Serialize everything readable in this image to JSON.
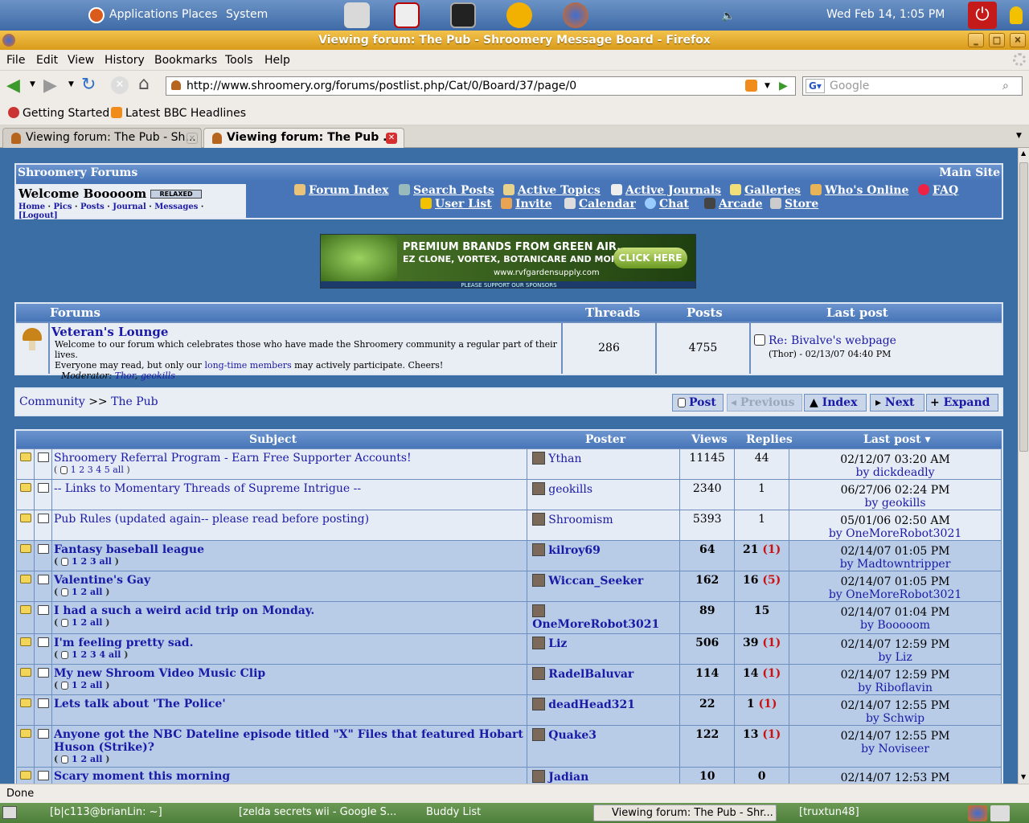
{
  "panel": {
    "applications": "Applications",
    "places": "Places",
    "system": "System",
    "clock": "Wed Feb 14,  1:05 PM"
  },
  "window": {
    "title": "Viewing forum: The Pub - Shroomery Message Board - Firefox"
  },
  "menubar": [
    "File",
    "Edit",
    "View",
    "History",
    "Bookmarks",
    "Tools",
    "Help"
  ],
  "navbar": {
    "url": "http://www.shroomery.org/forums/postlist.php/Cat/0/Board/37/page/0",
    "search_placeholder": "Google"
  },
  "bookmarks": [
    "Getting Started",
    "Latest BBC Headlines"
  ],
  "tabs": [
    {
      "label": "Viewing forum: The Pub - Sh..."
    },
    {
      "label": "Viewing forum: The Pub ..."
    }
  ],
  "forum": {
    "site_title": "Shroomery Forums",
    "main_site": "Main Site",
    "welcome": "Welcome Booooom",
    "mood": "RELAXED",
    "user_links": [
      "Home",
      "Pics",
      "Posts",
      "Journal",
      "Messages"
    ],
    "logout": "[Logout]",
    "nav_links": [
      "Forum Index",
      "Search Posts",
      "Active Topics",
      "Active Journals",
      "Galleries",
      "Who's Online",
      "FAQ",
      "User List",
      "Invite",
      "Calendar",
      "Chat",
      "Arcade",
      "Store"
    ],
    "ad": {
      "line1": "PREMIUM BRANDS FROM GREEN AIR,",
      "line2": "EZ CLONE, VORTEX, BOTANICARE AND MORE",
      "url": "www.rvfgardensupply.com",
      "cta": "CLICK HERE",
      "support": "PLEASE SUPPORT OUR SPONSORS"
    },
    "forums_table": {
      "headers": [
        "Forums",
        "Threads",
        "Posts",
        "Last post"
      ],
      "name": "Veteran's Lounge",
      "desc1": "Welcome to our forum which celebrates those who have made the Shroomery community a regular part of their lives.",
      "desc2a": "Everyone may read, but only our",
      "desc2link": "long-time members",
      "desc2b": "may actively participate. Cheers!",
      "moderator_label": "Moderator:",
      "moderators": [
        "Thor",
        "geokills"
      ],
      "threads": "286",
      "posts": "4755",
      "last_post_title": "Re: Bivalve's webpage",
      "last_post_meta": "(Thor) - 02/13/07 04:40 PM"
    },
    "breadcrumb": {
      "community": "Community",
      "sep": ">>",
      "current": "The Pub"
    },
    "buttons": {
      "post": "Post",
      "previous": "Previous",
      "index": "Index",
      "next": "Next",
      "expand": "Expand"
    },
    "thread_headers": {
      "subject": "Subject",
      "poster": "Poster",
      "views": "Views",
      "replies": "Replies",
      "last_post": "Last post"
    },
    "threads": [
      {
        "subject": "Shroomery Referral Program - Earn Free Supporter Accounts!",
        "pages": "1 2 3 4 5 all",
        "poster": "Ythan",
        "views": "11145",
        "replies": "44",
        "new": "",
        "date": "02/12/07 03:20 AM",
        "by": "by dickdeadly"
      },
      {
        "subject": "-- Links to Momentary Threads of Supreme Intrigue --",
        "pages": "",
        "poster": "geokills",
        "views": "2340",
        "replies": "1",
        "new": "",
        "date": "06/27/06 02:24 PM",
        "by": "by geokills"
      },
      {
        "subject": "Pub Rules (updated again-- please read before posting)",
        "pages": "",
        "poster": "Shroomism",
        "views": "5393",
        "replies": "1",
        "new": "",
        "date": "05/01/06 02:50 AM",
        "by": "by OneMoreRobot3021"
      },
      {
        "subject": "Fantasy baseball league",
        "pages": "1 2 3 all",
        "poster": "kilroy69",
        "views": "64",
        "replies": "21",
        "new": "(1)",
        "date": "02/14/07 01:05 PM",
        "by": "by Madtowntripper"
      },
      {
        "subject": "Valentine's Gay",
        "pages": "1 2 all",
        "poster": "Wiccan_Seeker",
        "views": "162",
        "replies": "16",
        "new": "(5)",
        "date": "02/14/07 01:05 PM",
        "by": "by OneMoreRobot3021"
      },
      {
        "subject": "I had a such a weird acid trip on Monday.",
        "pages": "1 2 all",
        "poster": "OneMoreRobot3021",
        "views": "89",
        "replies": "15",
        "new": "",
        "date": "02/14/07 01:04 PM",
        "by": "by Booooom"
      },
      {
        "subject": "I'm feeling pretty sad.",
        "pages": "1 2 3 4 all",
        "poster": "Liz",
        "views": "506",
        "replies": "39",
        "new": "(1)",
        "date": "02/14/07 12:59 PM",
        "by": "by Liz"
      },
      {
        "subject": "My new Shroom Video Music Clip",
        "pages": "1 2 all",
        "poster": "RadelBaluvar",
        "views": "114",
        "replies": "14",
        "new": "(1)",
        "date": "02/14/07 12:59 PM",
        "by": "by Riboflavin"
      },
      {
        "subject": "Lets talk about 'The Police'",
        "pages": "",
        "poster": "deadHead321",
        "views": "22",
        "replies": "1",
        "new": "(1)",
        "date": "02/14/07 12:55 PM",
        "by": "by Schwip"
      },
      {
        "subject": "Anyone got the NBC Dateline episode titled \"X\" Files that featured Hobart Huson (Strike)?",
        "pages": "1 2 all",
        "poster": "Quake3",
        "views": "122",
        "replies": "13",
        "new": "(1)",
        "date": "02/14/07 12:55 PM",
        "by": "by Noviseer"
      },
      {
        "subject": "Scary moment this morning",
        "pages": "",
        "poster": "Jadian",
        "views": "10",
        "replies": "0",
        "new": "",
        "date": "02/14/07 12:53 PM",
        "by": ""
      }
    ]
  },
  "status": "Done",
  "taskbar": [
    "[b|c113@brianLin: ~]",
    "[zelda secrets wii - Google S...",
    "Buddy List",
    "Viewing forum: The Pub - Shr...",
    "[truxtun48]"
  ],
  "colors": {
    "accent": "#3a6ea5",
    "titlebar": "#e8ad32",
    "header": "#4775b7"
  }
}
